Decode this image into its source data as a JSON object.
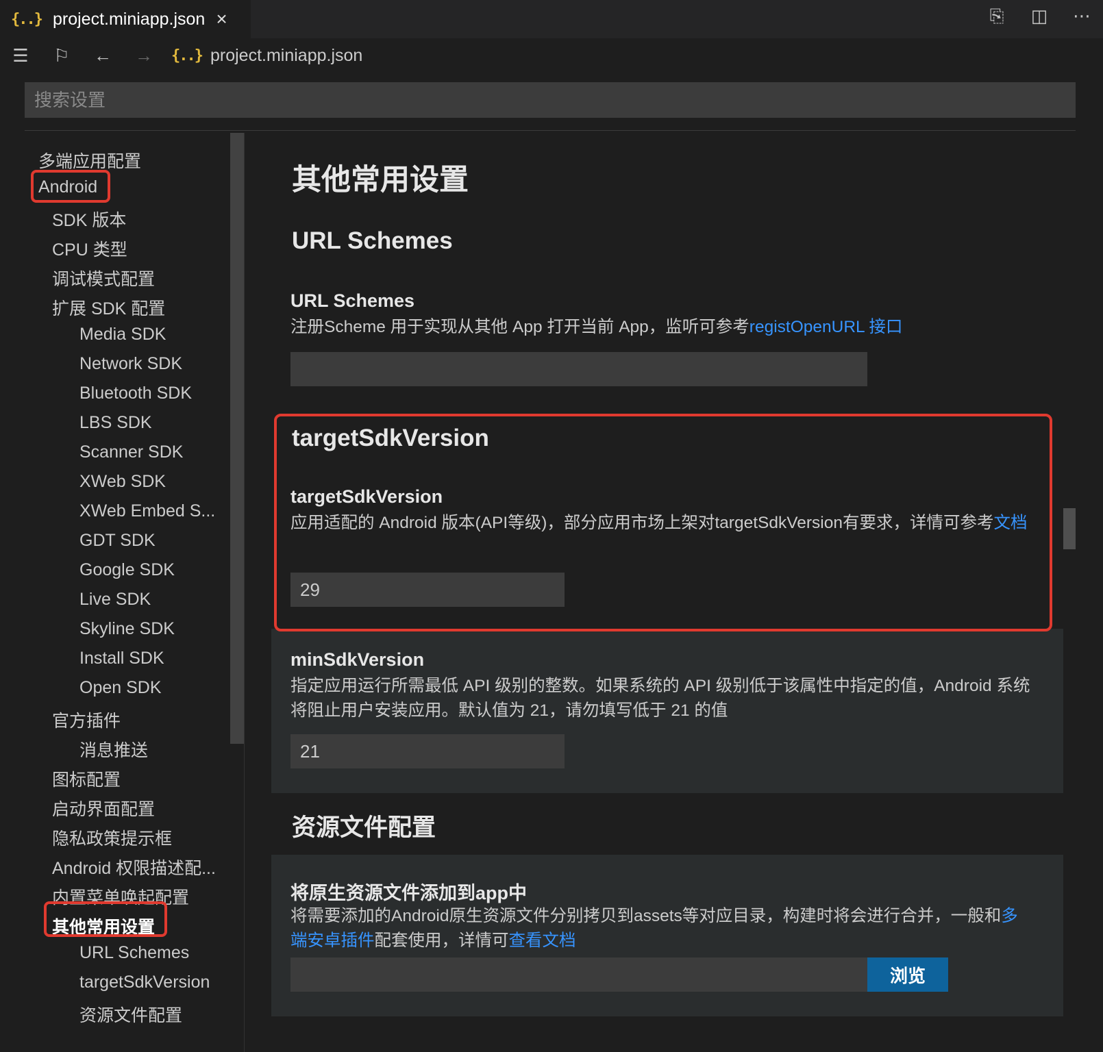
{
  "tab": {
    "title": "project.miniapp.json",
    "close": "×"
  },
  "tab_actions": [
    "open-changes-icon",
    "split-editor-icon",
    "more-actions-icon"
  ],
  "breadcrumb": {
    "file": "project.miniapp.json"
  },
  "search": {
    "placeholder": "搜索设置"
  },
  "toc": [
    {
      "label": "多端应用配置",
      "level": 0
    },
    {
      "label": "Android",
      "level": 0
    },
    {
      "label": "SDK 版本",
      "level": 1
    },
    {
      "label": "CPU 类型",
      "level": 1
    },
    {
      "label": "调试模式配置",
      "level": 1
    },
    {
      "label": "扩展 SDK 配置",
      "level": 1
    },
    {
      "label": "Media SDK",
      "level": 2
    },
    {
      "label": "Network SDK",
      "level": 2
    },
    {
      "label": "Bluetooth SDK",
      "level": 2
    },
    {
      "label": "LBS SDK",
      "level": 2
    },
    {
      "label": "Scanner SDK",
      "level": 2
    },
    {
      "label": "XWeb SDK",
      "level": 2
    },
    {
      "label": "XWeb Embed S...",
      "level": 2
    },
    {
      "label": "GDT SDK",
      "level": 2
    },
    {
      "label": "Google SDK",
      "level": 2
    },
    {
      "label": "Live SDK",
      "level": 2
    },
    {
      "label": "Skyline SDK",
      "level": 2
    },
    {
      "label": "Install SDK",
      "level": 2
    },
    {
      "label": "Open SDK",
      "level": 2
    },
    {
      "label": "官方插件",
      "level": 1
    },
    {
      "label": "消息推送",
      "level": 2
    },
    {
      "label": "图标配置",
      "level": 1
    },
    {
      "label": "启动界面配置",
      "level": 1
    },
    {
      "label": "隐私政策提示框",
      "level": 1
    },
    {
      "label": "Android 权限描述配...",
      "level": 1
    },
    {
      "label": "内置菜单唤起配置",
      "level": 1
    },
    {
      "label": "其他常用设置",
      "level": 1,
      "active": true
    },
    {
      "label": "URL Schemes",
      "level": 2
    },
    {
      "label": "targetSdkVersion",
      "level": 2
    },
    {
      "label": "资源文件配置",
      "level": 2
    }
  ],
  "content": {
    "page_title": "其他常用设置",
    "url_schemes": {
      "section": "URL Schemes",
      "title": "URL Schemes",
      "desc": "注册Scheme 用于实现从其他 App 打开当前 App，监听可参考",
      "link": "registOpenURL 接口",
      "value": ""
    },
    "target_sdk": {
      "section": "targetSdkVersion",
      "title": "targetSdkVersion",
      "desc": "应用适配的 Android 版本(API等级)，部分应用市场上架对targetSdkVersion有要求，详情可参考",
      "link": "文档",
      "value": "29"
    },
    "min_sdk": {
      "title": "minSdkVersion",
      "desc": "指定应用运行所需最低 API 级别的整数。如果系统的 API 级别低于该属性中指定的值，Android 系统将阻止用户安装应用。默认值为 21，请勿填写低于 21 的值",
      "value": "21"
    },
    "resources": {
      "section": "资源文件配置",
      "title": "将原生资源文件添加到app中",
      "desc_1": "将需要添加的Android原生资源文件分别拷贝到assets等对应目录，构建时将会进行合并，一般和",
      "link_1": "多端安卓插件",
      "desc_2": "配套使用，详情可",
      "link_2": "查看文档",
      "value": "",
      "browse": "浏览"
    }
  },
  "colors": {
    "highlight": "#e03a2f",
    "link": "#3794ff",
    "button": "#0e639c"
  }
}
